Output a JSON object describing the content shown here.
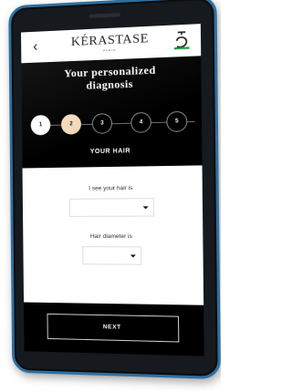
{
  "colors": {
    "device_frame_accent": "#2f6fa0",
    "device_body": "#16191d",
    "screen_background": "#000000",
    "active_step": "#f3d9b9",
    "panel_background": "#ffffff"
  },
  "header": {
    "back_icon": "chevron-left-icon",
    "brand": "KÉRASTASE",
    "brand_sub": "PARIS",
    "diagnosis_icon": "diagnosis-device-icon"
  },
  "title": {
    "line1": "Your personalized",
    "line2": "diagnosis"
  },
  "stepper": {
    "steps": [
      {
        "label": "1",
        "state": "done"
      },
      {
        "label": "2",
        "state": "active"
      },
      {
        "label": "3",
        "state": "todo"
      },
      {
        "label": "4",
        "state": "todo"
      },
      {
        "label": "5",
        "state": "todo"
      }
    ]
  },
  "section": {
    "label": "YOUR HAIR"
  },
  "form": {
    "field1_label": "I see your hair is",
    "field1_value": "",
    "field2_label": "Hair diameter is",
    "field2_value": ""
  },
  "footer": {
    "next_label": "NEXT"
  }
}
